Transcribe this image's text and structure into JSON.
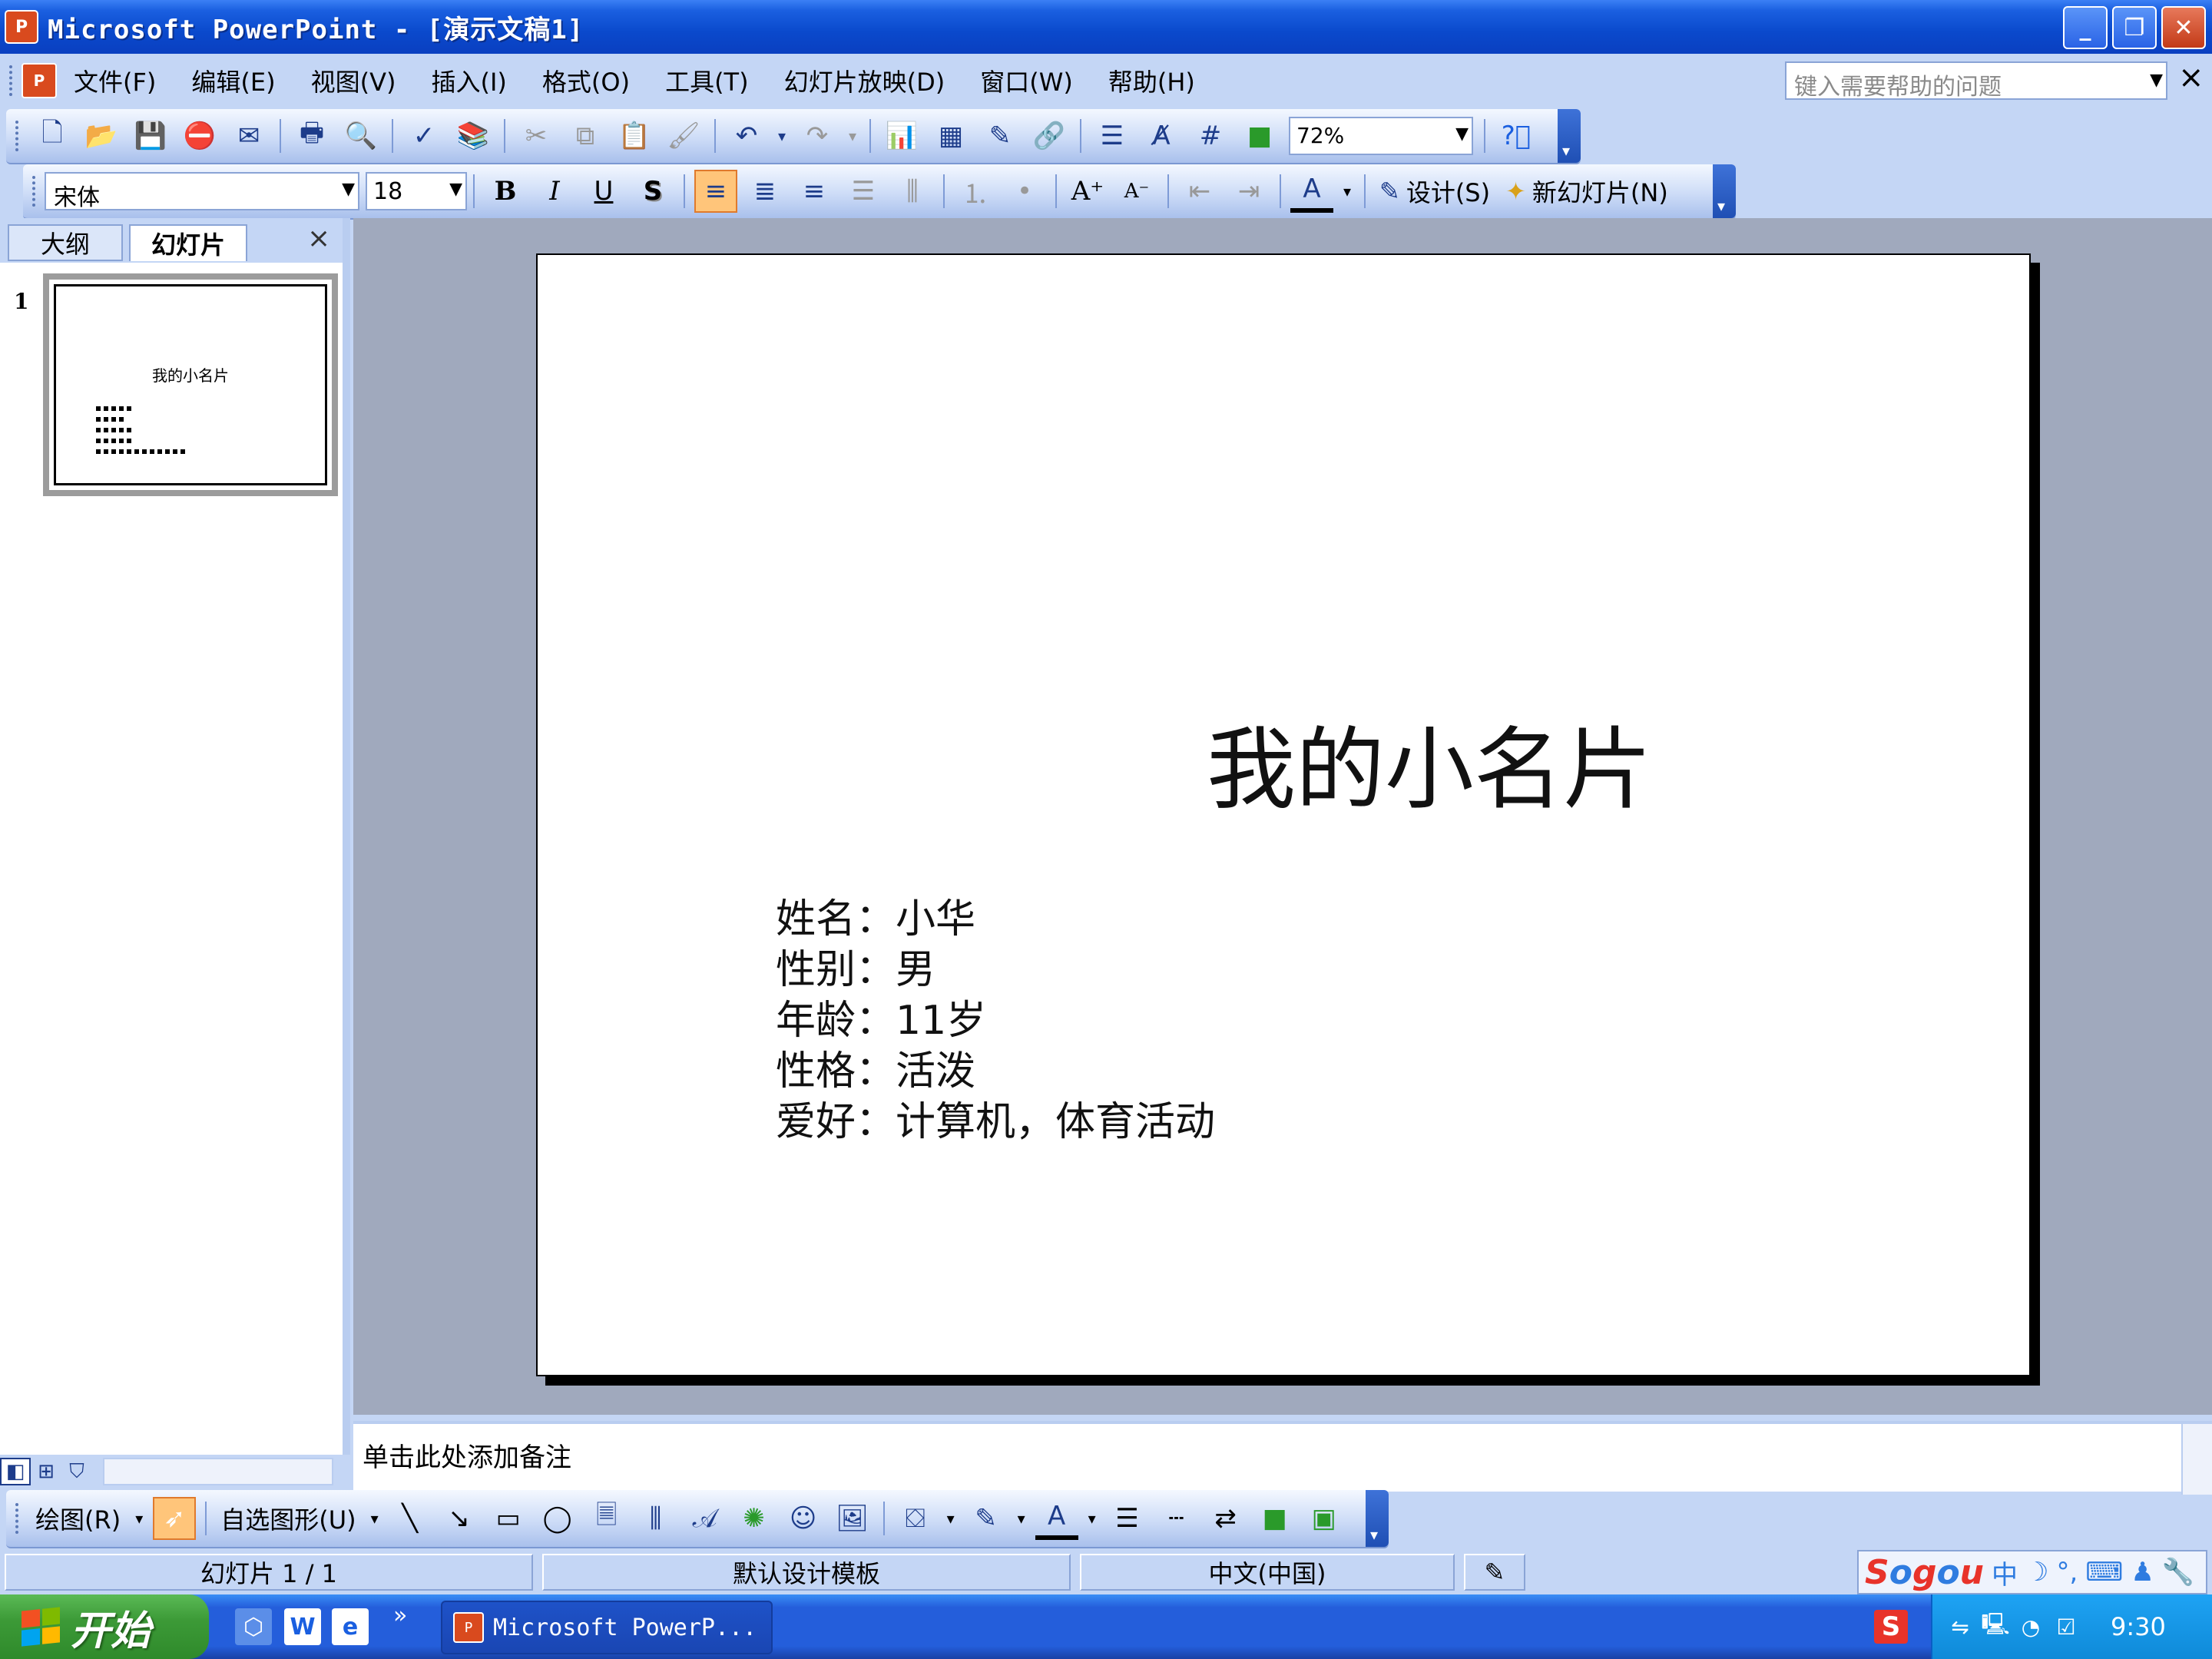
{
  "window": {
    "title": "Microsoft PowerPoint - [演示文稿1]",
    "app_icon": "powerpoint-icon",
    "controls": [
      "minimize",
      "restore",
      "close"
    ]
  },
  "menubar": {
    "items": [
      "文件(F)",
      "编辑(E)",
      "视图(V)",
      "插入(I)",
      "格式(O)",
      "工具(T)",
      "幻灯片放映(D)",
      "窗口(W)",
      "帮助(H)"
    ],
    "help_placeholder": "键入需要帮助的问题"
  },
  "standard_toolbar": {
    "zoom": "72%"
  },
  "formatting_toolbar": {
    "font": "宋体",
    "size": "18",
    "design_label": "设计(S)",
    "new_slide_label": "新幻灯片(N)"
  },
  "left_panel": {
    "tabs": [
      "大纲",
      "幻灯片"
    ],
    "active_tab": "幻灯片",
    "slide_number": "1",
    "thumb_title": "我的小名片"
  },
  "slide": {
    "title": "我的小名片",
    "lines": [
      "姓名：小华",
      "性别：男",
      "年龄：11岁",
      "性格：活泼",
      "爱好：计算机，体育活动"
    ]
  },
  "notes": {
    "placeholder": "单击此处添加备注"
  },
  "drawing_toolbar": {
    "draw_label": "绘图(R)",
    "autoshapes_label": "自选图形(U)"
  },
  "statusbar": {
    "slide_info": "幻灯片 1 / 1",
    "template": "默认设计模板",
    "language": "中文(中国)",
    "ime_text": "中"
  },
  "taskbar": {
    "start_label": "开始",
    "task_label": "Microsoft PowerP...",
    "clock": "9:30"
  },
  "colors": {
    "titlebar": "#0a49cc",
    "chrome": "#c4d6f5",
    "slide_bg": "#ffffff",
    "workspace": "#a0a9bd"
  }
}
